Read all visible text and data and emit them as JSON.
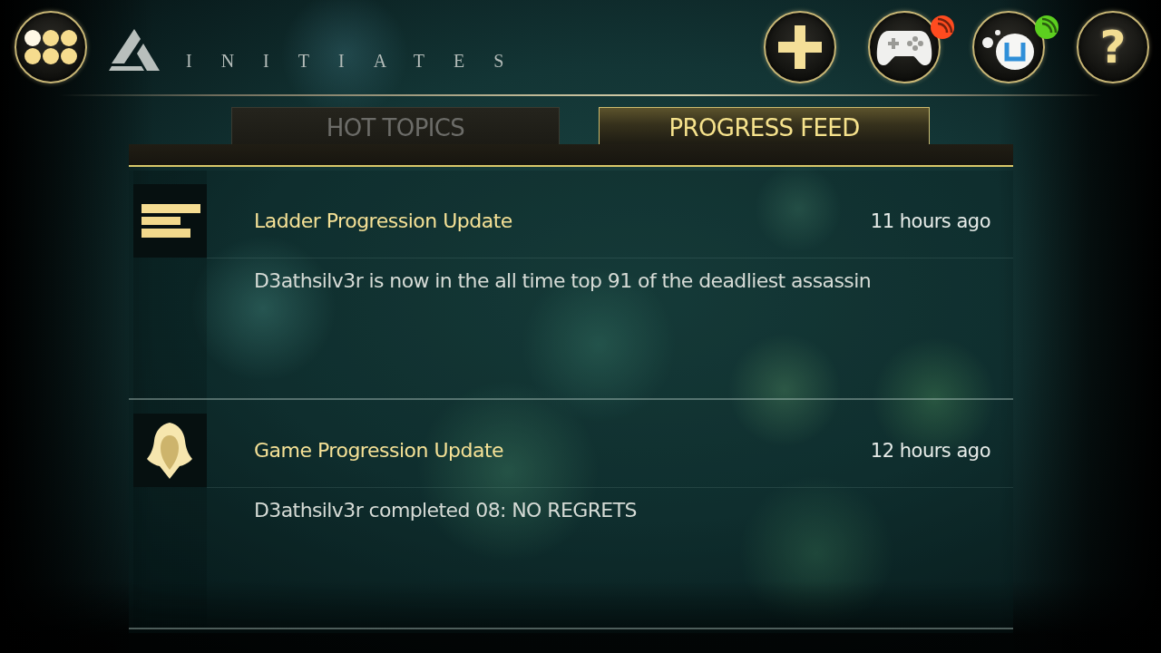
{
  "top_bar": {
    "brand": "INITIATES",
    "buttons": [
      {
        "kind": "add"
      },
      {
        "kind": "controller",
        "badge": {
          "color": "#ff4b1f"
        }
      },
      {
        "kind": "uplay",
        "badge": {
          "color": "#5ccf1f"
        }
      },
      {
        "kind": "help",
        "label": "?"
      }
    ]
  },
  "tabs": [
    {
      "label": "HOT TOPICS",
      "selected": false
    },
    {
      "label": "PROGRESS FEED",
      "selected": true
    }
  ],
  "feed": [
    {
      "kind": "ladder",
      "title": "Ladder Progression Update",
      "time": "11 hours ago",
      "text": "D3athsilv3r is now in the all time top 91 of the deadliest assassin"
    },
    {
      "kind": "game",
      "title": "Game Progression Update",
      "time": "12 hours ago",
      "text": "D3athsilv3r completed 08: NO REGRETS"
    }
  ]
}
